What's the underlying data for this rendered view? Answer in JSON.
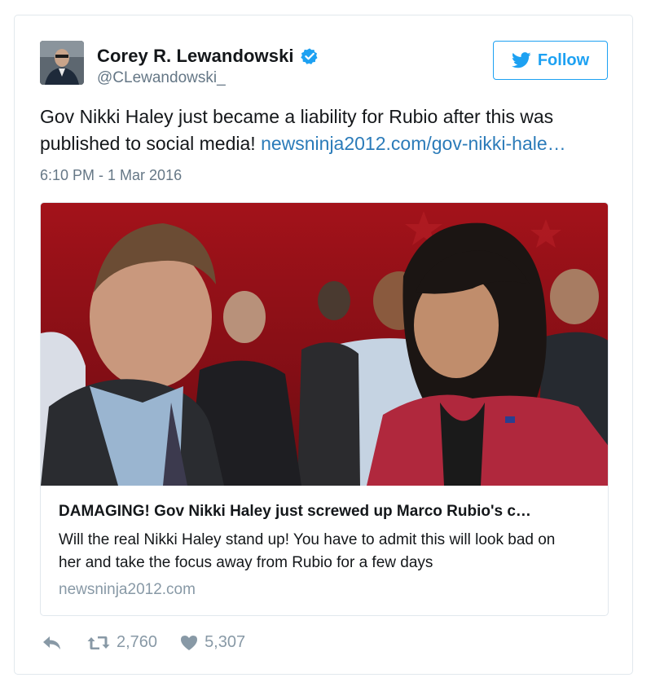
{
  "author": {
    "name": "Corey R. Lewandowski",
    "handle": "@CLewandowski_",
    "verified": true
  },
  "follow_button": {
    "label": "Follow",
    "icon": "twitter-bird-icon",
    "color": "#1da1f2"
  },
  "tweet": {
    "text": "Gov Nikki Haley just became a liability for Rubio after this was published to social media! ",
    "link_text": "newsninja2012.com/gov-nikki-hale…",
    "timestamp": "6:10 PM - 1 Mar 2016"
  },
  "card": {
    "title": "DAMAGING! Gov Nikki Haley just screwed up Marco Rubio's c…",
    "description": "Will the real Nikki Haley stand up! You have to admit this will look bad on her and take the focus away from Rubio for a few days",
    "domain": "newsninja2012.com"
  },
  "actions": {
    "reply_icon": "reply-icon",
    "retweet_icon": "retweet-icon",
    "retweet_count": "2,760",
    "like_icon": "heart-icon",
    "like_count": "5,307"
  },
  "colors": {
    "link": "#2b7bb9",
    "muted": "#657786",
    "border": "#e1e8ed",
    "verified": "#1da1f2"
  }
}
